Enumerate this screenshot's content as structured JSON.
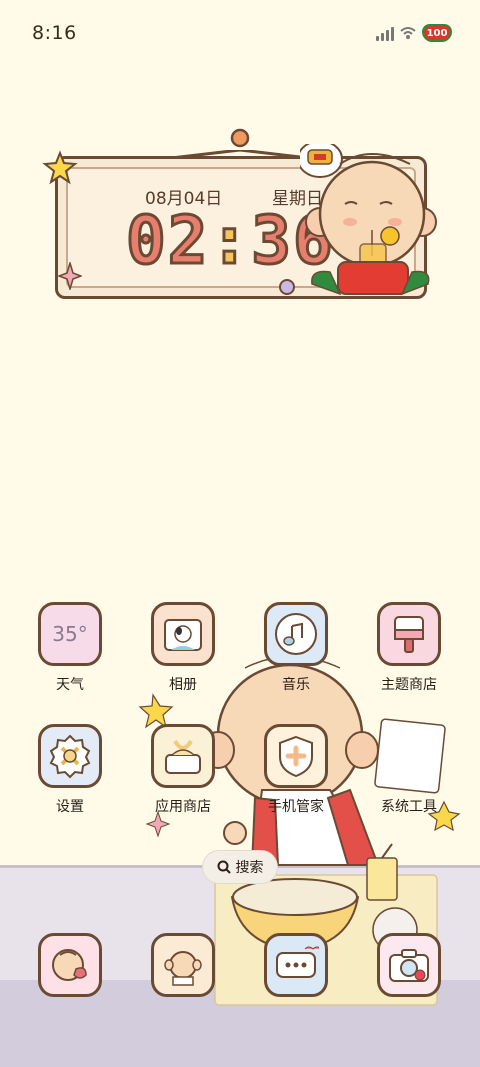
{
  "status_bar": {
    "time": "8:16",
    "battery": "100"
  },
  "clock_widget": {
    "date": "08月04日",
    "weekday": "星期日",
    "hour": "02",
    "minute": "36"
  },
  "apps": [
    {
      "label": "天气",
      "icon": "weather-icon",
      "temp": "35°"
    },
    {
      "label": "相册",
      "icon": "gallery-icon"
    },
    {
      "label": "音乐",
      "icon": "music-icon"
    },
    {
      "label": "主题商店",
      "icon": "theme-store-icon"
    },
    {
      "label": "设置",
      "icon": "settings-icon"
    },
    {
      "label": "应用商店",
      "icon": "app-store-icon"
    },
    {
      "label": "手机管家",
      "icon": "phone-manager-icon"
    },
    {
      "label": "系统工具",
      "icon": "system-tools-icon"
    }
  ],
  "search": {
    "label": "搜索"
  },
  "dock": [
    {
      "icon": "phone-icon"
    },
    {
      "icon": "contacts-icon"
    },
    {
      "icon": "messages-icon"
    },
    {
      "icon": "camera-icon"
    }
  ],
  "colors": {
    "background": "#fffbe8",
    "outline": "#6b4a34",
    "accent_red": "#e87f6e",
    "accent_yellow": "#f4c55a"
  }
}
